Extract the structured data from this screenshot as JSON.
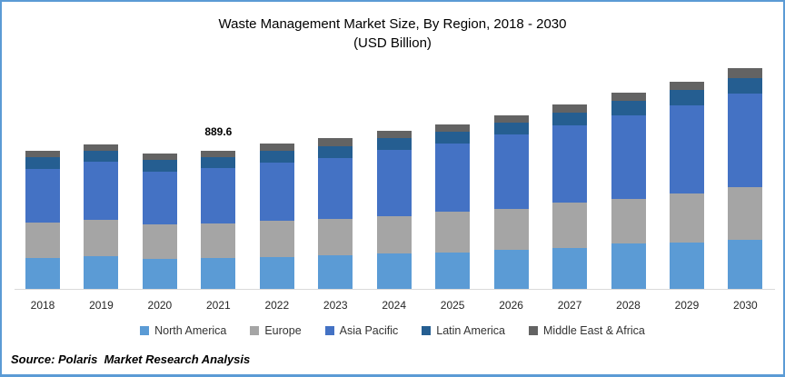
{
  "title": {
    "line1": "Waste Management Market Size, By Region, 2018 - 2030",
    "line2": "(USD Billion)"
  },
  "source": "Source: Polaris  Market Research Analysis",
  "annotation": {
    "category": "2021",
    "label": "889.6"
  },
  "colors": {
    "border": "#5B9BD5",
    "axis_line": "#D9D9D9",
    "north_america": "#5B9BD5",
    "europe": "#A5A5A5",
    "asia_pacific": "#4472C4",
    "latin_america": "#255E91",
    "middle_east_africa": "#636363"
  },
  "chart_data": {
    "type": "bar",
    "stacked": true,
    "title": "Waste Management Market Size, By Region, 2018 - 2030 (USD Billion)",
    "unit": "USD Billion",
    "categories": [
      "2018",
      "2019",
      "2020",
      "2021",
      "2022",
      "2023",
      "2024",
      "2025",
      "2026",
      "2027",
      "2028",
      "2029",
      "2030"
    ],
    "series": [
      {
        "name": "North America",
        "color": "#5B9BD5",
        "values": [
          199,
          209,
          196,
          200.0,
          207,
          219,
          230,
          236,
          250,
          266,
          293,
          300,
          315
        ]
      },
      {
        "name": "Europe",
        "color": "#A5A5A5",
        "values": [
          229,
          236,
          220,
          220.0,
          230,
          230,
          240,
          264,
          268,
          289,
          288,
          316,
          342
        ]
      },
      {
        "name": "Asia Pacific",
        "color": "#4472C4",
        "values": [
          348,
          373,
          342,
          360.0,
          379,
          397,
          424,
          440,
          477,
          497,
          541,
          569,
          604
        ]
      },
      {
        "name": "Latin America",
        "color": "#255E91",
        "values": [
          74,
          71,
          74,
          69.6,
          74,
          72,
          78,
          72,
          76,
          82,
          90,
          98,
          101
        ]
      },
      {
        "name": "Middle East & Africa",
        "color": "#636363",
        "values": [
          40,
          45,
          44,
          40.0,
          47,
          54,
          45,
          51,
          51,
          55,
          56,
          55,
          64
        ]
      }
    ],
    "totals": [
      890,
      934,
      876,
      889.6,
      937,
      972,
      1017,
      1063,
      1122,
      1189,
      1268,
      1338,
      1426
    ],
    "data_labels": [
      {
        "category": "2021",
        "value": 889.6
      }
    ],
    "axes": {
      "y_axis_visible": false,
      "gridlines": false,
      "x_axis_line": true
    },
    "legend_position": "bottom"
  }
}
